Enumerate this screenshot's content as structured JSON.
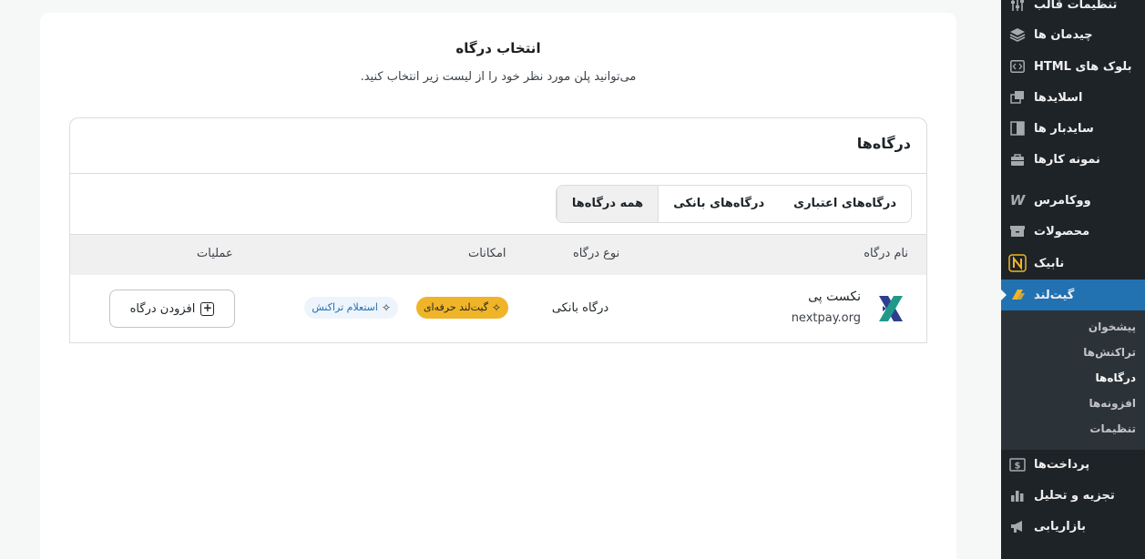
{
  "main": {
    "title": "انتخاب درگاه",
    "subtitle": "می‌توانید پلن مورد نظر خود را از لیست زیر انتخاب کنید.",
    "box_title": "درگاه‌ها"
  },
  "tabs": [
    {
      "label": "همه درگاه‌ها",
      "active": true
    },
    {
      "label": "درگاه‌های بانکی",
      "active": false
    },
    {
      "label": "درگاه‌های اعتباری",
      "active": false
    }
  ],
  "table": {
    "headers": {
      "name": "نام درگاه",
      "type": "نوع درگاه",
      "features": "امکانات",
      "actions": "عملیات"
    },
    "rows": [
      {
        "name": "نکست پی",
        "domain": "nextpay.org",
        "type": "درگاه بانکی",
        "badge_pro": "گیت‌لند حرفه‌ای",
        "badge_inquiry": "استعلام تراکنش",
        "action": "افزودن درگاه"
      }
    ]
  },
  "sidebar": {
    "items": [
      {
        "label": "تنظیمات قالب",
        "icon": "sliders-icon"
      },
      {
        "label": "چیدمان ها",
        "icon": "layers-icon"
      },
      {
        "label": "بلوک های HTML",
        "icon": "code-block-icon"
      },
      {
        "label": "اسلایدها",
        "icon": "slides-icon"
      },
      {
        "label": "سایدبار ها",
        "icon": "sidebar-icon"
      },
      {
        "label": "نمونه کارها",
        "icon": "briefcase-icon"
      },
      {
        "label": "ووکامرس",
        "icon": "woocommerce-icon"
      },
      {
        "label": "محصولات",
        "icon": "archive-icon"
      },
      {
        "label": "نابیک",
        "icon": "nabik-icon"
      },
      {
        "label": "گیت‌لند",
        "icon": "gateland-icon"
      },
      {
        "label": "پرداخت‌ها",
        "icon": "dollar-icon"
      },
      {
        "label": "تجزیه و تحلیل",
        "icon": "bar-chart-icon"
      },
      {
        "label": "بازاریابی",
        "icon": "megaphone-icon"
      }
    ],
    "submenu": [
      {
        "label": "پیشخوان",
        "current": false
      },
      {
        "label": "تراکنش‌ها",
        "current": false
      },
      {
        "label": "درگاه‌ها",
        "current": true
      },
      {
        "label": "افزونه‌ها",
        "current": false
      },
      {
        "label": "تنظیمات",
        "current": false
      }
    ]
  },
  "colors": {
    "accent": "#2271b1",
    "sidebar_bg": "#1d2327",
    "badge_pro_bg": "#f0b429",
    "badge_inquiry_bg": "#eef4fb"
  }
}
